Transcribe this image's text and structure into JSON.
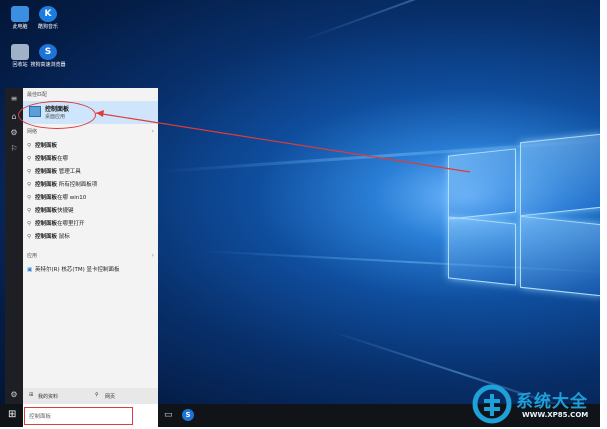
{
  "desktop": {
    "icons": [
      {
        "id": "this-pc",
        "label": "此电脑",
        "color": "#3c8ee0"
      },
      {
        "id": "kugou",
        "label": "酷狗音乐",
        "color": "#1a7de0"
      },
      {
        "id": "recycle-bin",
        "label": "回收站",
        "color": "#9fb2c8"
      },
      {
        "id": "sogou-browser",
        "label": "搜狗高速浏览器",
        "color": "#1d74d8"
      }
    ]
  },
  "start_panel": {
    "best_match_header": "最佳匹配",
    "best_match": {
      "title": "控制面板",
      "subtitle": "桌面应用"
    },
    "web_header": "网络",
    "web_results": [
      {
        "bold": "控制面板",
        "rest": ""
      },
      {
        "bold": "控制面板",
        "rest": "在哪"
      },
      {
        "bold": "控制面板",
        "rest": "管理工具"
      },
      {
        "bold": "控制面板",
        "rest": "所有控制面板项"
      },
      {
        "bold": "控制面板",
        "rest": "在哪 win10"
      },
      {
        "bold": "控制面板",
        "rest": "快捷键"
      },
      {
        "bold": "控制面板",
        "rest": "在哪里打开"
      },
      {
        "bold": "控制面板",
        "rest": "鼠标"
      }
    ],
    "apps_header": "应用",
    "apps": [
      {
        "label": "英特尔(R) 核芯(TM) 显卡控制面板"
      }
    ],
    "bottom": {
      "my_stuff": "我的资料",
      "web": "网页"
    }
  },
  "search": {
    "value": "控制面板"
  },
  "watermark": {
    "brand": "系统大全",
    "url": "WWW.XP85.COM"
  },
  "colors": {
    "highlight": "#e03a3a",
    "accent": "#0078d7"
  }
}
